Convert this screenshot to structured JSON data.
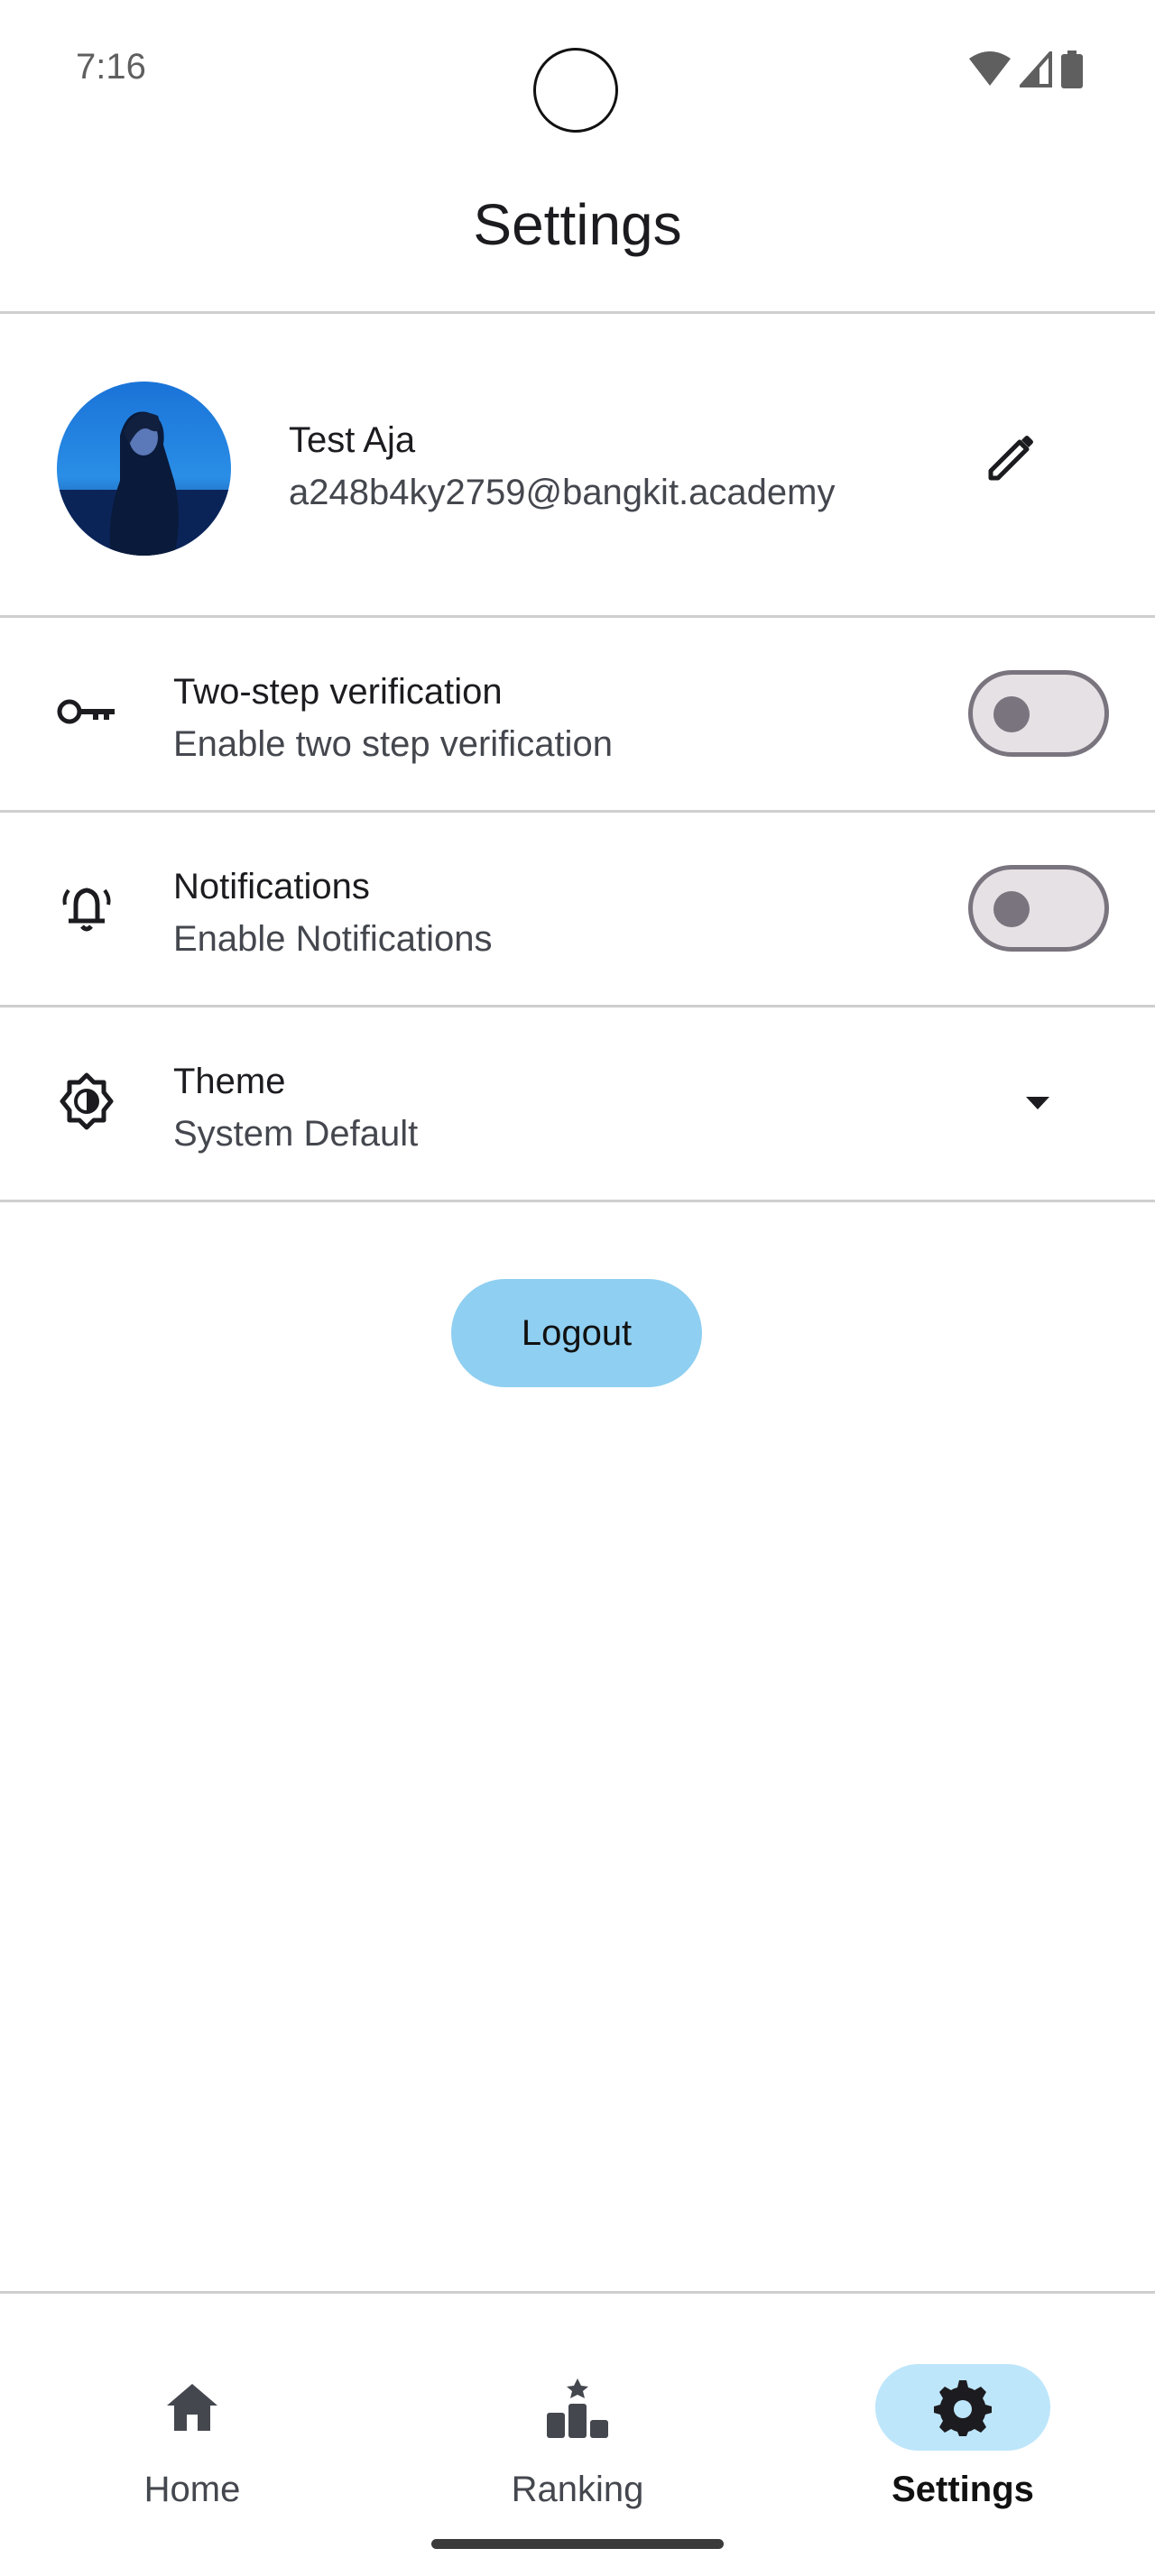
{
  "status_bar": {
    "time": "7:16"
  },
  "header": {
    "title": "Settings"
  },
  "profile": {
    "name": "Test Aja",
    "email": "a248b4ky2759@bangkit.academy"
  },
  "settings": {
    "two_step": {
      "title": "Two-step verification",
      "subtitle": "Enable two step verification",
      "enabled": false
    },
    "notifications": {
      "title": "Notifications",
      "subtitle": "Enable Notifications",
      "enabled": false
    },
    "theme": {
      "title": "Theme",
      "subtitle": "System Default"
    }
  },
  "actions": {
    "logout_label": "Logout"
  },
  "bottom_nav": {
    "items": [
      {
        "label": "Home",
        "icon": "home-icon",
        "active": false
      },
      {
        "label": "Ranking",
        "icon": "ranking-icon",
        "active": false
      },
      {
        "label": "Settings",
        "icon": "gear-icon",
        "active": true
      }
    ]
  },
  "colors": {
    "accent": "#8fcff1",
    "nav_active_pill": "#bde6fb",
    "toggle_track": "#e6e1e5",
    "toggle_outline": "#79747e"
  }
}
